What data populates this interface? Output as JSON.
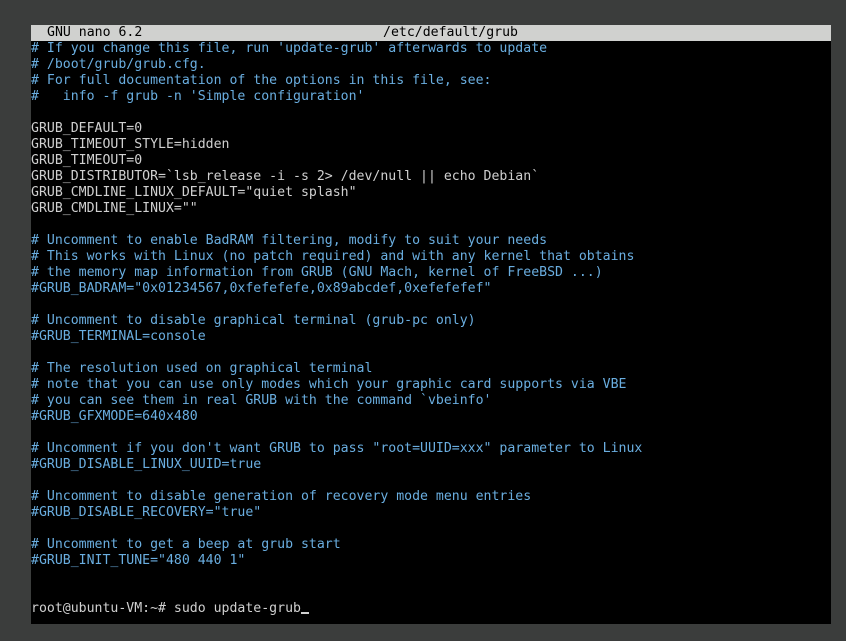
{
  "titlebar": {
    "app": "GNU nano 6.2",
    "file": "/etc/default/grub"
  },
  "lines": [
    {
      "type": "comment",
      "text": "# If you change this file, run 'update-grub' afterwards to update"
    },
    {
      "type": "comment",
      "text": "# /boot/grub/grub.cfg."
    },
    {
      "type": "comment",
      "text": "# For full documentation of the options in this file, see:"
    },
    {
      "type": "comment",
      "text": "#   info -f grub -n 'Simple configuration'"
    },
    {
      "type": "blank",
      "text": ""
    },
    {
      "type": "code",
      "text": "GRUB_DEFAULT=0"
    },
    {
      "type": "code",
      "text": "GRUB_TIMEOUT_STYLE=hidden"
    },
    {
      "type": "code",
      "text": "GRUB_TIMEOUT=0"
    },
    {
      "type": "code",
      "text": "GRUB_DISTRIBUTOR=`lsb_release -i -s 2> /dev/null || echo Debian`"
    },
    {
      "type": "code",
      "text": "GRUB_CMDLINE_LINUX_DEFAULT=\"quiet splash\""
    },
    {
      "type": "code",
      "text": "GRUB_CMDLINE_LINUX=\"\""
    },
    {
      "type": "blank",
      "text": ""
    },
    {
      "type": "comment",
      "text": "# Uncomment to enable BadRAM filtering, modify to suit your needs"
    },
    {
      "type": "comment",
      "text": "# This works with Linux (no patch required) and with any kernel that obtains"
    },
    {
      "type": "comment",
      "text": "# the memory map information from GRUB (GNU Mach, kernel of FreeBSD ...)"
    },
    {
      "type": "comment",
      "text": "#GRUB_BADRAM=\"0x01234567,0xfefefefe,0x89abcdef,0xefefefef\""
    },
    {
      "type": "blank",
      "text": ""
    },
    {
      "type": "comment",
      "text": "# Uncomment to disable graphical terminal (grub-pc only)"
    },
    {
      "type": "comment",
      "text": "#GRUB_TERMINAL=console"
    },
    {
      "type": "blank",
      "text": ""
    },
    {
      "type": "comment",
      "text": "# The resolution used on graphical terminal"
    },
    {
      "type": "comment",
      "text": "# note that you can use only modes which your graphic card supports via VBE"
    },
    {
      "type": "comment",
      "text": "# you can see them in real GRUB with the command `vbeinfo'"
    },
    {
      "type": "comment",
      "text": "#GRUB_GFXMODE=640x480"
    },
    {
      "type": "blank",
      "text": ""
    },
    {
      "type": "comment",
      "text": "# Uncomment if you don't want GRUB to pass \"root=UUID=xxx\" parameter to Linux"
    },
    {
      "type": "comment",
      "text": "#GRUB_DISABLE_LINUX_UUID=true"
    },
    {
      "type": "blank",
      "text": ""
    },
    {
      "type": "comment",
      "text": "# Uncomment to disable generation of recovery mode menu entries"
    },
    {
      "type": "comment",
      "text": "#GRUB_DISABLE_RECOVERY=\"true\""
    },
    {
      "type": "blank",
      "text": ""
    },
    {
      "type": "comment",
      "text": "# Uncomment to get a beep at grub start"
    },
    {
      "type": "comment",
      "text": "#GRUB_INIT_TUNE=\"480 440 1\""
    }
  ],
  "prompt": {
    "text": "root@ubuntu-VM:~# sudo update-grub"
  },
  "colors": {
    "comment": "#6aaee0",
    "code": "#d0d0d0",
    "titlebar_bg": "#d0d1cf",
    "terminal_bg": "#000000",
    "desktop_bg": "#3b3d3c"
  }
}
